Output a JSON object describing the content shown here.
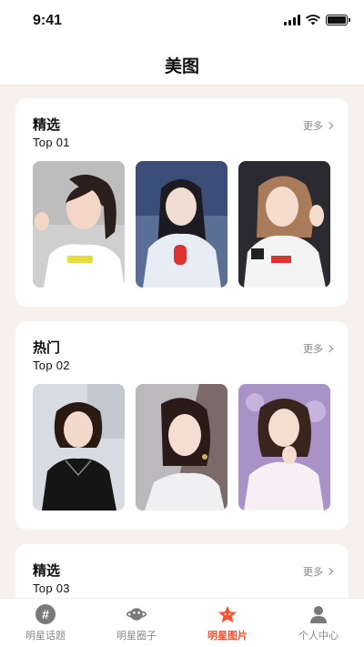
{
  "status": {
    "time": "9:41"
  },
  "nav": {
    "title": "美图"
  },
  "sections": [
    {
      "title": "精选",
      "subtitle": "Top 01",
      "more": "更多"
    },
    {
      "title": "热门",
      "subtitle": "Top 02",
      "more": "更多"
    },
    {
      "title": "精选",
      "subtitle": "Top 03",
      "more": "更多"
    }
  ],
  "tabs": [
    {
      "label": "明星话题",
      "icon": "hashtag-icon"
    },
    {
      "label": "明星圈子",
      "icon": "planet-icon"
    },
    {
      "label": "明星图片",
      "icon": "star-icon",
      "active": true
    },
    {
      "label": "个人中心",
      "icon": "user-icon"
    }
  ],
  "colors": {
    "accent": "#ff4d2d",
    "background": "#f6f1ee",
    "inactive": "#888888"
  }
}
